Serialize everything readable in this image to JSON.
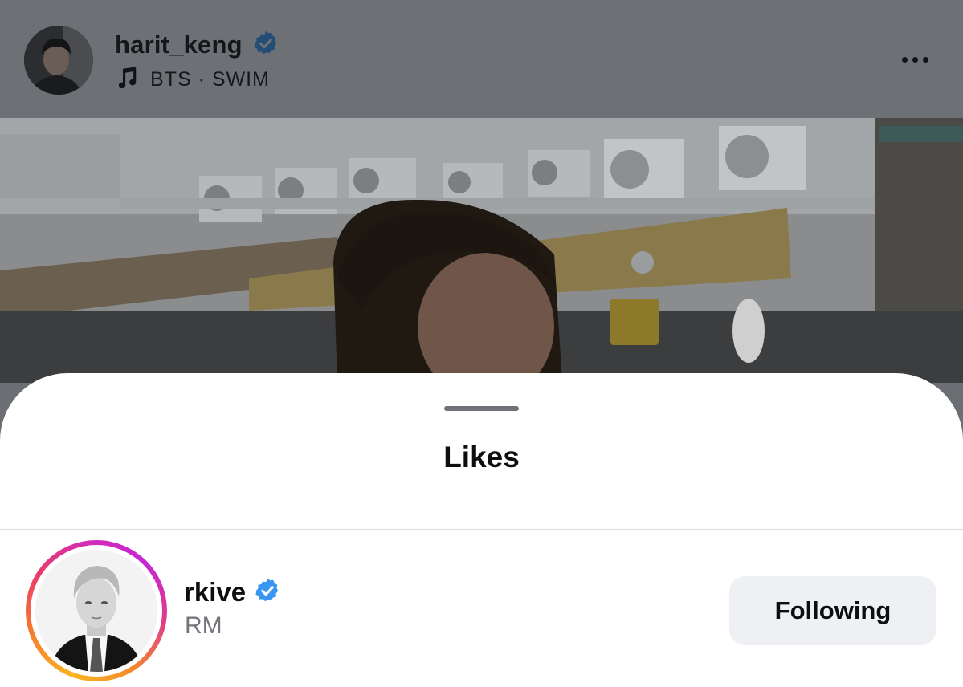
{
  "colors": {
    "verified_blue": "#3897f0",
    "overlay_dim": "#6d7075",
    "sheet_bg": "#ffffff",
    "following_button_bg": "#eff0f4",
    "secondary_text": "#72767b"
  },
  "post": {
    "username": "harit_keng",
    "verified": true,
    "music": {
      "icon": "music-note-icon",
      "text": "BTS · SWIM"
    },
    "more_icon": "more-options-icon"
  },
  "likes_sheet": {
    "title": "Likes",
    "users": [
      {
        "username": "rkive",
        "verified": true,
        "full_name": "RM",
        "has_story_ring": true,
        "button_label": "Following"
      }
    ]
  }
}
